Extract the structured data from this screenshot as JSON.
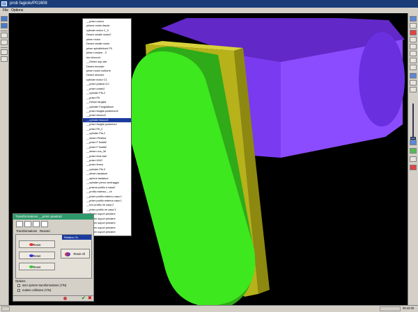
{
  "window": {
    "title": "prob fagiolo/P01608"
  },
  "menu": {
    "items": [
      "File",
      "Options"
    ]
  },
  "object_list": {
    "items": [
      "__prism carrco",
      "prisma motor fascia",
      "cylinder motor C_0",
      "Desen rotatie motor2",
      "prism motor",
      "Desen rotatie motor",
      "prism spindleblock P0",
      "prism ruroane - 0",
      "box blocco4",
      "__Desen sup-ata",
      "Desen encoder",
      "prism motor coriturre",
      "Desen senzore",
      "cylinder motor C1",
      "__prism piastra 3-0",
      "__prism carter2",
      "__cylinder Pik-2",
      "__prism Pit",
      "__Desen fangilal",
      "__cylinder Fangilalbum",
      "__prism fangila posteriore2",
      "__prism blocco3",
      "__cylinder blocco3",
      "__prism fangila posteriore",
      "__prism Pit_2",
      "__cylinder Pik-2",
      "__desen Pristina",
      "__prism F finalit2",
      "__prism F finalit2",
      "__desen cuo_3d",
      "__prism time ball",
      "__prism UNO",
      "__prism fermo",
      "__cylinder Pik-3",
      "__desen tastatore",
      "__sphere tastatore",
      "__cylinder perno centraggio",
      "__prisma profilo a casa2",
      "__profilo esterno----rit",
      "__prism profilo esterno casa 1",
      "__prism profilo esterna casa 1",
      "__box profilo ne casa 2",
      "__prism profilo ne casa 3",
      "__Desen suport prindere",
      "__Desen suport prindere",
      "__Desen suport prindere",
      "__Desen suport prindere",
      "__Desen suport prindere",
      "__cylinder centralli",
      "__prism suport tamburo"
    ],
    "selected_index": 22
  },
  "dialog": {
    "title": "Transformations    __prism piastra2",
    "tabs": [
      "Transformations",
      "Reseta l"
    ],
    "relation_to": "Relation To",
    "buttons": {
      "reset_translate": "Reset",
      "reset_rotate": "Reset",
      "reset_scale": "Reset",
      "reset_all": "Reset All"
    },
    "options_title": "Options",
    "options": [
      "sem system transformations (Y/N)",
      "makes collisions (Y/N)"
    ]
  },
  "status": {
    "time": "00:42:00"
  },
  "colors": {
    "background": "#000000",
    "green_part": "#3de81e",
    "olive_part": "#b7b21a",
    "purple_part": "#7434ee",
    "selection": "#1b3c9e"
  },
  "icons": {
    "left_toolbar": [
      "select-icon",
      "move-icon",
      "new-file-icon",
      "save-icon",
      "open-icon",
      "print-icon"
    ],
    "right_toolbar": [
      "view-front-icon",
      "view-side-icon",
      "view-top-icon",
      "zoom-icon",
      "rotate-icon",
      "pan-icon",
      "fit-icon",
      "wireframe-icon",
      "shaded-icon",
      "light-icon",
      "camera-icon",
      "collision-icon",
      "measure-icon",
      "axis-icon",
      "grid-icon"
    ]
  }
}
